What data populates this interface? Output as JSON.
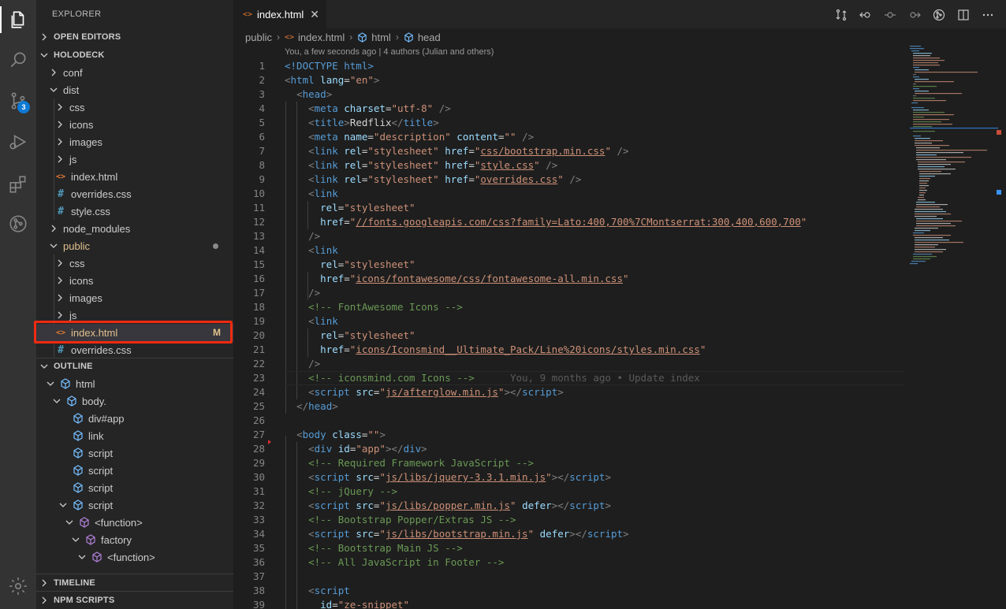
{
  "sidebar": {
    "title": "EXPLORER",
    "open_editors": "OPEN EDITORS",
    "project": "HOLODECK",
    "tree": [
      {
        "label": "conf",
        "type": "folder",
        "expanded": false
      },
      {
        "label": "dist",
        "type": "folder",
        "expanded": true
      },
      {
        "label": "css",
        "type": "folder",
        "expanded": false
      },
      {
        "label": "icons",
        "type": "folder",
        "expanded": false
      },
      {
        "label": "images",
        "type": "folder",
        "expanded": false
      },
      {
        "label": "js",
        "type": "folder",
        "expanded": false
      },
      {
        "label": "index.html",
        "type": "html"
      },
      {
        "label": "overrides.css",
        "type": "css"
      },
      {
        "label": "style.css",
        "type": "css"
      },
      {
        "label": "node_modules",
        "type": "folder",
        "expanded": false
      },
      {
        "label": "public",
        "type": "folder",
        "expanded": true
      },
      {
        "label": "css",
        "type": "folder",
        "expanded": false
      },
      {
        "label": "icons",
        "type": "folder",
        "expanded": false
      },
      {
        "label": "images",
        "type": "folder",
        "expanded": false
      },
      {
        "label": "js",
        "type": "folder",
        "expanded": false
      },
      {
        "label": "index.html",
        "type": "html",
        "status": "M"
      },
      {
        "label": "overrides.css",
        "type": "css"
      }
    ],
    "outline_title": "OUTLINE",
    "outline": [
      {
        "label": "html",
        "level": 1,
        "kind": "element"
      },
      {
        "label": "body.",
        "level": 2,
        "kind": "element"
      },
      {
        "label": "div#app",
        "level": 3,
        "kind": "element"
      },
      {
        "label": "link",
        "level": 3,
        "kind": "element"
      },
      {
        "label": "script",
        "level": 3,
        "kind": "element"
      },
      {
        "label": "script",
        "level": 3,
        "kind": "element"
      },
      {
        "label": "script",
        "level": 3,
        "kind": "element"
      },
      {
        "label": "script",
        "level": 2,
        "kind": "element"
      },
      {
        "label": "<function>",
        "level": 3,
        "kind": "function"
      },
      {
        "label": "factory",
        "level": 4,
        "kind": "function"
      },
      {
        "label": "<function>",
        "level": 5,
        "kind": "function"
      }
    ],
    "timeline": "TIMELINE",
    "npm_scripts": "NPM SCRIPTS"
  },
  "activity": {
    "source_control_badge": "3"
  },
  "tab": {
    "label": "index.html",
    "close": "✕"
  },
  "breadcrumb": [
    "public",
    "index.html",
    "html",
    "head"
  ],
  "editor": {
    "codelens": "You, a few seconds ago | 4 authors (Julian and others)",
    "blame": "You, 9 months ago • Update index",
    "lines": [
      "1",
      "2",
      "3",
      "4",
      "5",
      "6",
      "7",
      "8",
      "9",
      "10",
      "11",
      "12",
      "13",
      "14",
      "15",
      "16",
      "17",
      "18",
      "19",
      "20",
      "21",
      "22",
      "23",
      "24",
      "25",
      "26",
      "27",
      "28",
      "29",
      "30",
      "31",
      "32",
      "33",
      "34",
      "35",
      "36",
      "37",
      "38",
      "39"
    ],
    "strings": {
      "doctype": "<!DOCTYPE html>",
      "lang": "\"en\"",
      "charset": "\"utf-8\"",
      "title": "Redflix",
      "description": "\"description\"",
      "empty": "\"\"",
      "bootstrap_css": "css/bootstrap.min.css",
      "style_css": "style.css",
      "overrides_css": "overrides.css",
      "stylesheet": "\"stylesheet\"",
      "fonts_url": "//fonts.googleapis.com/css?family=Lato:400,700%7CMontserrat:300,400,600,700",
      "fontawesome_url": "icons/fontawesome/css/fontawesome-all.min.css",
      "fa_comment": "<!-- FontAwesome Icons -->",
      "iconsmind_url": "icons/Iconsmind__Ultimate_Pack/Line%20icons/styles.min.css",
      "iconsmind_comment": "<!-- iconsmind.com Icons -->",
      "afterglow": "js/afterglow.min.js",
      "app_id": "\"app\"",
      "framework_comment": "<!-- Required Framework JavaScript -->",
      "jquery": "js/libs/jquery-3.3.1.min.js",
      "jquery_comment": "<!-- jQuery -->",
      "popper": "js/libs/popper.min.js",
      "popper_comment": "<!-- Bootstrap Popper/Extras JS -->",
      "bootstrap_js": "js/libs/bootstrap.min.js",
      "bootstrap_comment": "<!-- Bootstrap Main JS -->",
      "footer_comment": "<!-- All JavaScript in Footer -->",
      "ze_snippet": "\"ze-snippet\""
    }
  }
}
